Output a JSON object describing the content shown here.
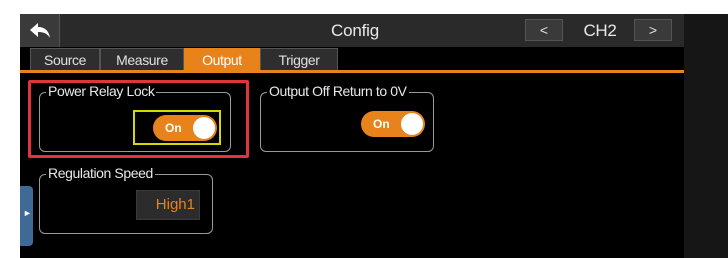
{
  "header": {
    "title": "Config",
    "prev_label": "<",
    "channel": "CH2",
    "next_label": ">"
  },
  "tabs": [
    {
      "label": "Source"
    },
    {
      "label": "Measure"
    },
    {
      "label": "Output"
    },
    {
      "label": "Trigger"
    }
  ],
  "active_tab": "Output",
  "groups": {
    "power_relay_lock": {
      "label": "Power Relay Lock",
      "toggle": "On"
    },
    "output_off_return": {
      "label": "Output Off Return to 0V",
      "toggle": "On"
    },
    "regulation_speed": {
      "label": "Regulation Speed",
      "value": "High1"
    }
  },
  "icons": {
    "back": "back-arrow-icon",
    "side": "expand-right-icon"
  },
  "side_handle": {
    "glyph": "►"
  },
  "colors": {
    "accent": "#e8831c",
    "focus": "#d8d800",
    "highlight": "#e0353b",
    "side_handle": "#3f6a96"
  }
}
